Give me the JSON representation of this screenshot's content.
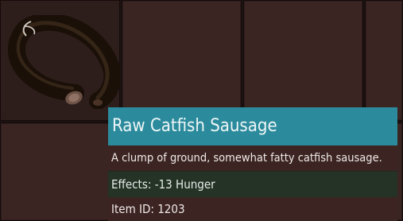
{
  "inventory": {
    "selected_item": {
      "name": "Raw Catfish Sausage",
      "icon": "sausage-icon",
      "description": "A clump of ground, somewhat fatty catfish sausage.",
      "effects_label": "Effects:",
      "effects_value": "-13 Hunger",
      "item_id_label": "Item ID:",
      "item_id_value": "1203"
    }
  },
  "colors": {
    "title_bar": "#2b8b9c",
    "effects_bar": "#253327",
    "slot_bg": "#3a2523",
    "tooltip_bg": "#3b2422"
  }
}
